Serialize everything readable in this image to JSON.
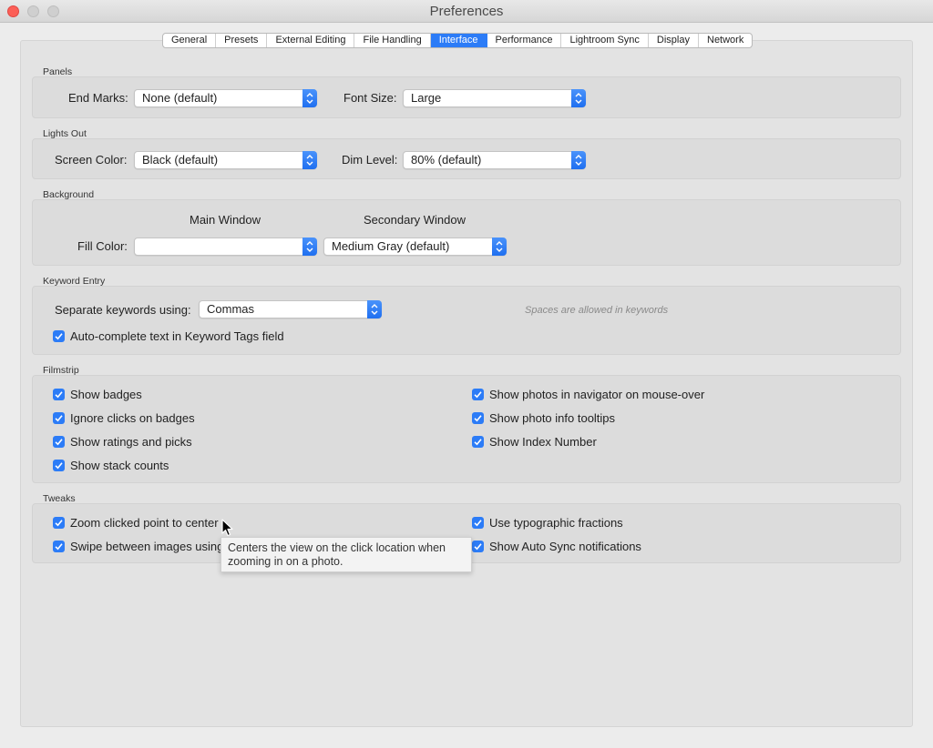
{
  "window": {
    "title": "Preferences"
  },
  "tabs": [
    {
      "label": "General"
    },
    {
      "label": "Presets"
    },
    {
      "label": "External Editing"
    },
    {
      "label": "File Handling"
    },
    {
      "label": "Interface"
    },
    {
      "label": "Performance"
    },
    {
      "label": "Lightroom Sync"
    },
    {
      "label": "Display"
    },
    {
      "label": "Network"
    }
  ],
  "active_tab": "Interface",
  "panels": {
    "title": "Panels",
    "end_marks_label": "End Marks:",
    "end_marks_value": "None (default)",
    "font_size_label": "Font Size:",
    "font_size_value": "Large"
  },
  "lights_out": {
    "title": "Lights Out",
    "screen_color_label": "Screen Color:",
    "screen_color_value": "Black (default)",
    "dim_level_label": "Dim Level:",
    "dim_level_value": "80% (default)"
  },
  "background": {
    "title": "Background",
    "main_window_label": "Main Window",
    "secondary_window_label": "Secondary Window",
    "fill_color_label": "Fill Color:",
    "main_fill_value": "",
    "secondary_fill_value": "Medium Gray (default)"
  },
  "keyword_entry": {
    "title": "Keyword Entry",
    "separate_label": "Separate keywords using:",
    "separate_value": "Commas",
    "hint": "Spaces are allowed in keywords",
    "autocomplete_label": "Auto-complete text in Keyword Tags field",
    "autocomplete_checked": true
  },
  "filmstrip": {
    "title": "Filmstrip",
    "left": [
      {
        "label": "Show badges",
        "checked": true
      },
      {
        "label": "Ignore clicks on badges",
        "checked": true
      },
      {
        "label": "Show ratings and picks",
        "checked": true
      },
      {
        "label": "Show stack counts",
        "checked": true
      }
    ],
    "right": [
      {
        "label": "Show photos in navigator on mouse-over",
        "checked": true
      },
      {
        "label": "Show photo info tooltips",
        "checked": true
      },
      {
        "label": "Show Index Number",
        "checked": true
      }
    ]
  },
  "tweaks": {
    "title": "Tweaks",
    "left": [
      {
        "label": "Zoom clicked point to center",
        "checked": true
      },
      {
        "label": "Swipe between images using",
        "checked": true
      }
    ],
    "right": [
      {
        "label": "Use typographic fractions",
        "checked": true
      },
      {
        "label": "Show Auto Sync notifications",
        "checked": true
      }
    ]
  },
  "tooltip": {
    "text": "Centers the view on the click location when zooming in on a photo."
  },
  "colors": {
    "accent": "#2c7cf7",
    "close_button": "#fc5f57",
    "window_bg": "#ececec"
  },
  "icons": {
    "checkmark": "checkmark-icon",
    "stepper": "updown-chevron-icon",
    "cursor": "arrow-cursor-icon"
  }
}
